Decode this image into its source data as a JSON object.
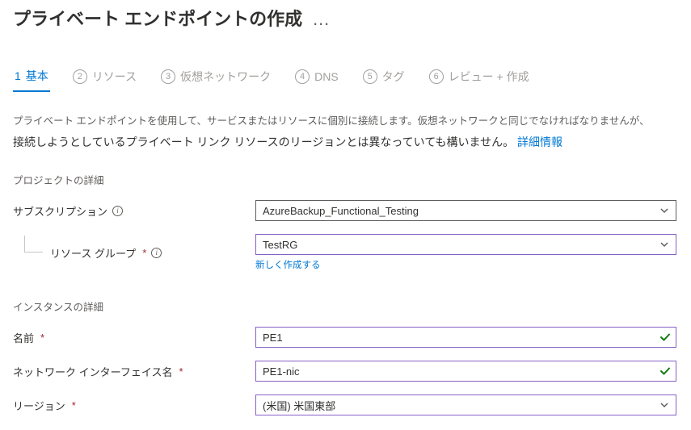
{
  "header": {
    "title": "プライベート エンドポイントの作成",
    "ellipsis": "…"
  },
  "tabs": [
    {
      "num": "1",
      "label": "基本"
    },
    {
      "num": "2",
      "label": "リソース"
    },
    {
      "num": "3",
      "label": "仮想ネットワーク"
    },
    {
      "num": "4",
      "label": "DNS"
    },
    {
      "num": "5",
      "label": "タグ"
    },
    {
      "num": "6",
      "label": "レビュー + 作成"
    }
  ],
  "description": {
    "line1": "プライベート エンドポイントを使用して、サービスまたはリソースに個別に接続します。仮想ネットワークと同じでなければなりませんが、",
    "line2_a": "接続しようとしているプライベート リンク リソースのリージョンとは異なっていても構いません。",
    "link": "詳細情報"
  },
  "sections": {
    "project": "プロジェクトの詳細",
    "instance": "インスタンスの詳細"
  },
  "labels": {
    "subscription": "サブスクリプション",
    "resourceGroup": "リソース グループ",
    "createNew": "新しく作成する",
    "name": "名前",
    "nicName": "ネットワーク インターフェイス名",
    "region": "リージョン"
  },
  "values": {
    "subscription": "AzureBackup_Functional_Testing",
    "resourceGroup": "TestRG",
    "name": "PE1",
    "nicName": "PE1-nic",
    "region": "(米国) 米国東部"
  }
}
